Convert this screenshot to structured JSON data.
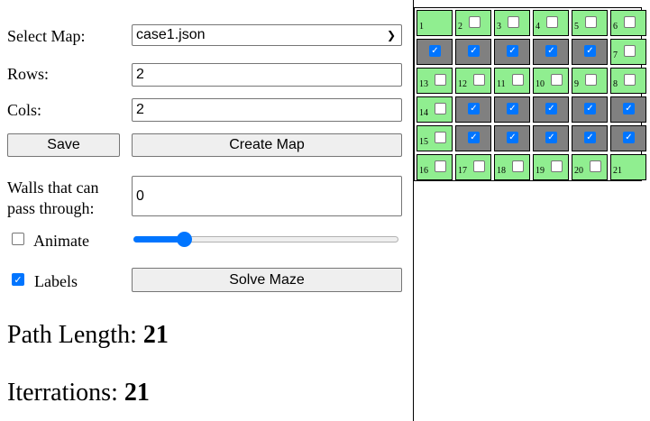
{
  "controls": {
    "select_map_label": "Select Map:",
    "select_map_value": "case1.json",
    "rows_label": "Rows:",
    "rows_value": "2",
    "cols_label": "Cols:",
    "cols_value": "2",
    "save_label": "Save",
    "create_map_label": "Create Map",
    "walls_label_line1": "Walls that can",
    "walls_label_line2": "pass through:",
    "walls_value": "0",
    "animate_label": "Animate",
    "animate_checked": false,
    "animate_slider_fraction": 0.19,
    "labels_label": "Labels",
    "labels_checked": true,
    "solve_label": "Solve Maze"
  },
  "results": {
    "path_length_label": "Path Length:",
    "path_length_value": "21",
    "iterations_label": "Iterrations:",
    "iterations_value": "21"
  },
  "grid": {
    "colors": {
      "open": "#90ee90",
      "wall": "#808080",
      "accent": "#0075ff"
    },
    "cells": [
      {
        "label": "1",
        "type": "open",
        "checkbox": "none"
      },
      {
        "label": "2",
        "type": "open",
        "checkbox": "unchecked"
      },
      {
        "label": "3",
        "type": "open",
        "checkbox": "unchecked"
      },
      {
        "label": "4",
        "type": "open",
        "checkbox": "unchecked"
      },
      {
        "label": "5",
        "type": "open",
        "checkbox": "unchecked"
      },
      {
        "label": "6",
        "type": "open",
        "checkbox": "unchecked"
      },
      {
        "label": "",
        "type": "wall",
        "checkbox": "checked"
      },
      {
        "label": "",
        "type": "wall",
        "checkbox": "checked"
      },
      {
        "label": "",
        "type": "wall",
        "checkbox": "checked"
      },
      {
        "label": "",
        "type": "wall",
        "checkbox": "checked"
      },
      {
        "label": "",
        "type": "wall",
        "checkbox": "checked"
      },
      {
        "label": "7",
        "type": "open",
        "checkbox": "unchecked"
      },
      {
        "label": "13",
        "type": "open",
        "checkbox": "unchecked"
      },
      {
        "label": "12",
        "type": "open",
        "checkbox": "unchecked"
      },
      {
        "label": "11",
        "type": "open",
        "checkbox": "unchecked"
      },
      {
        "label": "10",
        "type": "open",
        "checkbox": "unchecked"
      },
      {
        "label": "9",
        "type": "open",
        "checkbox": "unchecked"
      },
      {
        "label": "8",
        "type": "open",
        "checkbox": "unchecked"
      },
      {
        "label": "14",
        "type": "open",
        "checkbox": "unchecked"
      },
      {
        "label": "",
        "type": "wall",
        "checkbox": "checked"
      },
      {
        "label": "",
        "type": "wall",
        "checkbox": "checked"
      },
      {
        "label": "",
        "type": "wall",
        "checkbox": "checked"
      },
      {
        "label": "",
        "type": "wall",
        "checkbox": "checked"
      },
      {
        "label": "",
        "type": "wall",
        "checkbox": "checked"
      },
      {
        "label": "15",
        "type": "open",
        "checkbox": "unchecked"
      },
      {
        "label": "",
        "type": "wall",
        "checkbox": "checked"
      },
      {
        "label": "",
        "type": "wall",
        "checkbox": "checked"
      },
      {
        "label": "",
        "type": "wall",
        "checkbox": "checked"
      },
      {
        "label": "",
        "type": "wall",
        "checkbox": "checked"
      },
      {
        "label": "",
        "type": "wall",
        "checkbox": "checked"
      },
      {
        "label": "16",
        "type": "open",
        "checkbox": "unchecked"
      },
      {
        "label": "17",
        "type": "open",
        "checkbox": "unchecked"
      },
      {
        "label": "18",
        "type": "open",
        "checkbox": "unchecked"
      },
      {
        "label": "19",
        "type": "open",
        "checkbox": "unchecked"
      },
      {
        "label": "20",
        "type": "open",
        "checkbox": "unchecked"
      },
      {
        "label": "21",
        "type": "open",
        "checkbox": "none"
      }
    ]
  }
}
